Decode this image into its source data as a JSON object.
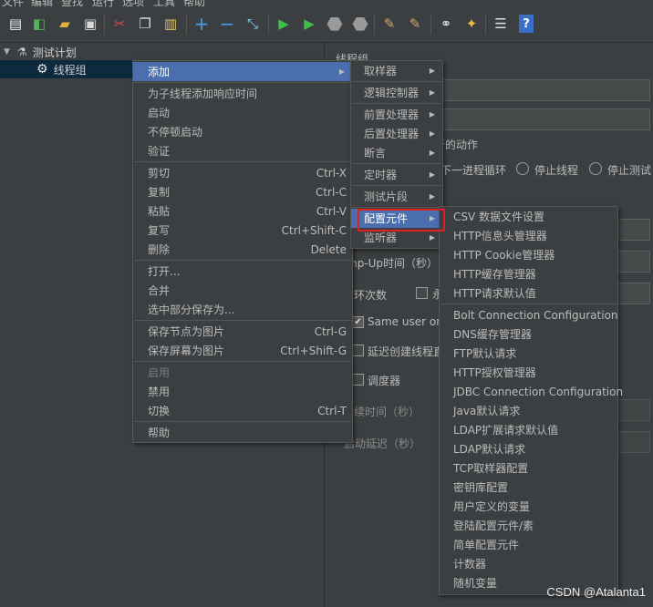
{
  "menubar": [
    "文件",
    "编辑",
    "查找",
    "运行",
    "选项",
    "工具",
    "帮助"
  ],
  "tree": {
    "root_label": "测试计划",
    "child_label": "线程组"
  },
  "right_panel": {
    "title": "线程组",
    "error_action_heading": "行的动作",
    "radio_next_loop": "下一进程循环",
    "radio_stop_thread": "停止线程",
    "radio_stop_test": "停止测试",
    "rampup_label": "mp-Up时间（秒）",
    "loop_label": "环次数",
    "loop_forever_frag": "永",
    "same_user_label": "Same user on e",
    "delay_create_label": "延迟创建线程直",
    "scheduler_label": "调度器",
    "duration_label": "续时间（秒）",
    "startup_delay_label": "启动延迟（秒）"
  },
  "context_menu": {
    "items": [
      {
        "label": "添加",
        "shortcut": "",
        "submenu": true,
        "selected": true
      },
      {
        "sep": true
      },
      {
        "label": "为子线程添加响应时间",
        "shortcut": ""
      },
      {
        "label": "启动",
        "shortcut": ""
      },
      {
        "label": "不停顿启动",
        "shortcut": ""
      },
      {
        "label": "验证",
        "shortcut": ""
      },
      {
        "sep": true
      },
      {
        "label": "剪切",
        "shortcut": "Ctrl-X"
      },
      {
        "label": "复制",
        "shortcut": "Ctrl-C"
      },
      {
        "label": "粘贴",
        "shortcut": "Ctrl-V"
      },
      {
        "label": "复写",
        "shortcut": "Ctrl+Shift-C"
      },
      {
        "label": "删除",
        "shortcut": "Delete"
      },
      {
        "sep": true
      },
      {
        "label": "打开...",
        "shortcut": ""
      },
      {
        "label": "合并",
        "shortcut": ""
      },
      {
        "label": "选中部分保存为...",
        "shortcut": ""
      },
      {
        "sep": true
      },
      {
        "label": "保存节点为图片",
        "shortcut": "Ctrl-G"
      },
      {
        "label": "保存屏幕为图片",
        "shortcut": "Ctrl+Shift-G"
      },
      {
        "sep": true
      },
      {
        "label": "启用",
        "shortcut": "",
        "disabled": true
      },
      {
        "label": "禁用",
        "shortcut": ""
      },
      {
        "label": "切换",
        "shortcut": "Ctrl-T"
      },
      {
        "sep": true
      },
      {
        "label": "帮助",
        "shortcut": ""
      }
    ]
  },
  "add_submenu": {
    "items": [
      {
        "label": "取样器",
        "submenu": true
      },
      {
        "sep": true
      },
      {
        "label": "逻辑控制器",
        "submenu": true
      },
      {
        "sep": true
      },
      {
        "label": "前置处理器",
        "submenu": true
      },
      {
        "label": "后置处理器",
        "submenu": true
      },
      {
        "label": "断言",
        "submenu": true
      },
      {
        "sep": true
      },
      {
        "label": "定时器",
        "submenu": true
      },
      {
        "sep": true
      },
      {
        "label": "测试片段",
        "submenu": true
      },
      {
        "sep": true
      },
      {
        "label": "配置元件",
        "submenu": true,
        "selected": true
      },
      {
        "label": "监听器",
        "submenu": true
      }
    ]
  },
  "config_submenu": {
    "items": [
      {
        "label": "CSV 数据文件设置"
      },
      {
        "label": "HTTP信息头管理器"
      },
      {
        "label": "HTTP Cookie管理器"
      },
      {
        "label": "HTTP缓存管理器"
      },
      {
        "label": "HTTP请求默认值"
      },
      {
        "sep": true
      },
      {
        "label": "Bolt Connection Configuration"
      },
      {
        "label": "DNS缓存管理器"
      },
      {
        "label": "FTP默认请求"
      },
      {
        "label": "HTTP授权管理器"
      },
      {
        "label": "JDBC Connection Configuration"
      },
      {
        "label": "Java默认请求"
      },
      {
        "label": "LDAP扩展请求默认值"
      },
      {
        "label": "LDAP默认请求"
      },
      {
        "label": "TCP取样器配置"
      },
      {
        "label": "密钥库配置"
      },
      {
        "label": "用户定义的变量"
      },
      {
        "label": "登陆配置元件/素"
      },
      {
        "label": "简单配置元件"
      },
      {
        "label": "计数器"
      },
      {
        "label": "随机变量"
      }
    ]
  },
  "watermark": "CSDN @Atalanta1",
  "colors": {
    "background": "#3c3f41",
    "selection": "#4b6eaf",
    "highlight_box": "#e02020",
    "text": "#bbbbbb"
  }
}
